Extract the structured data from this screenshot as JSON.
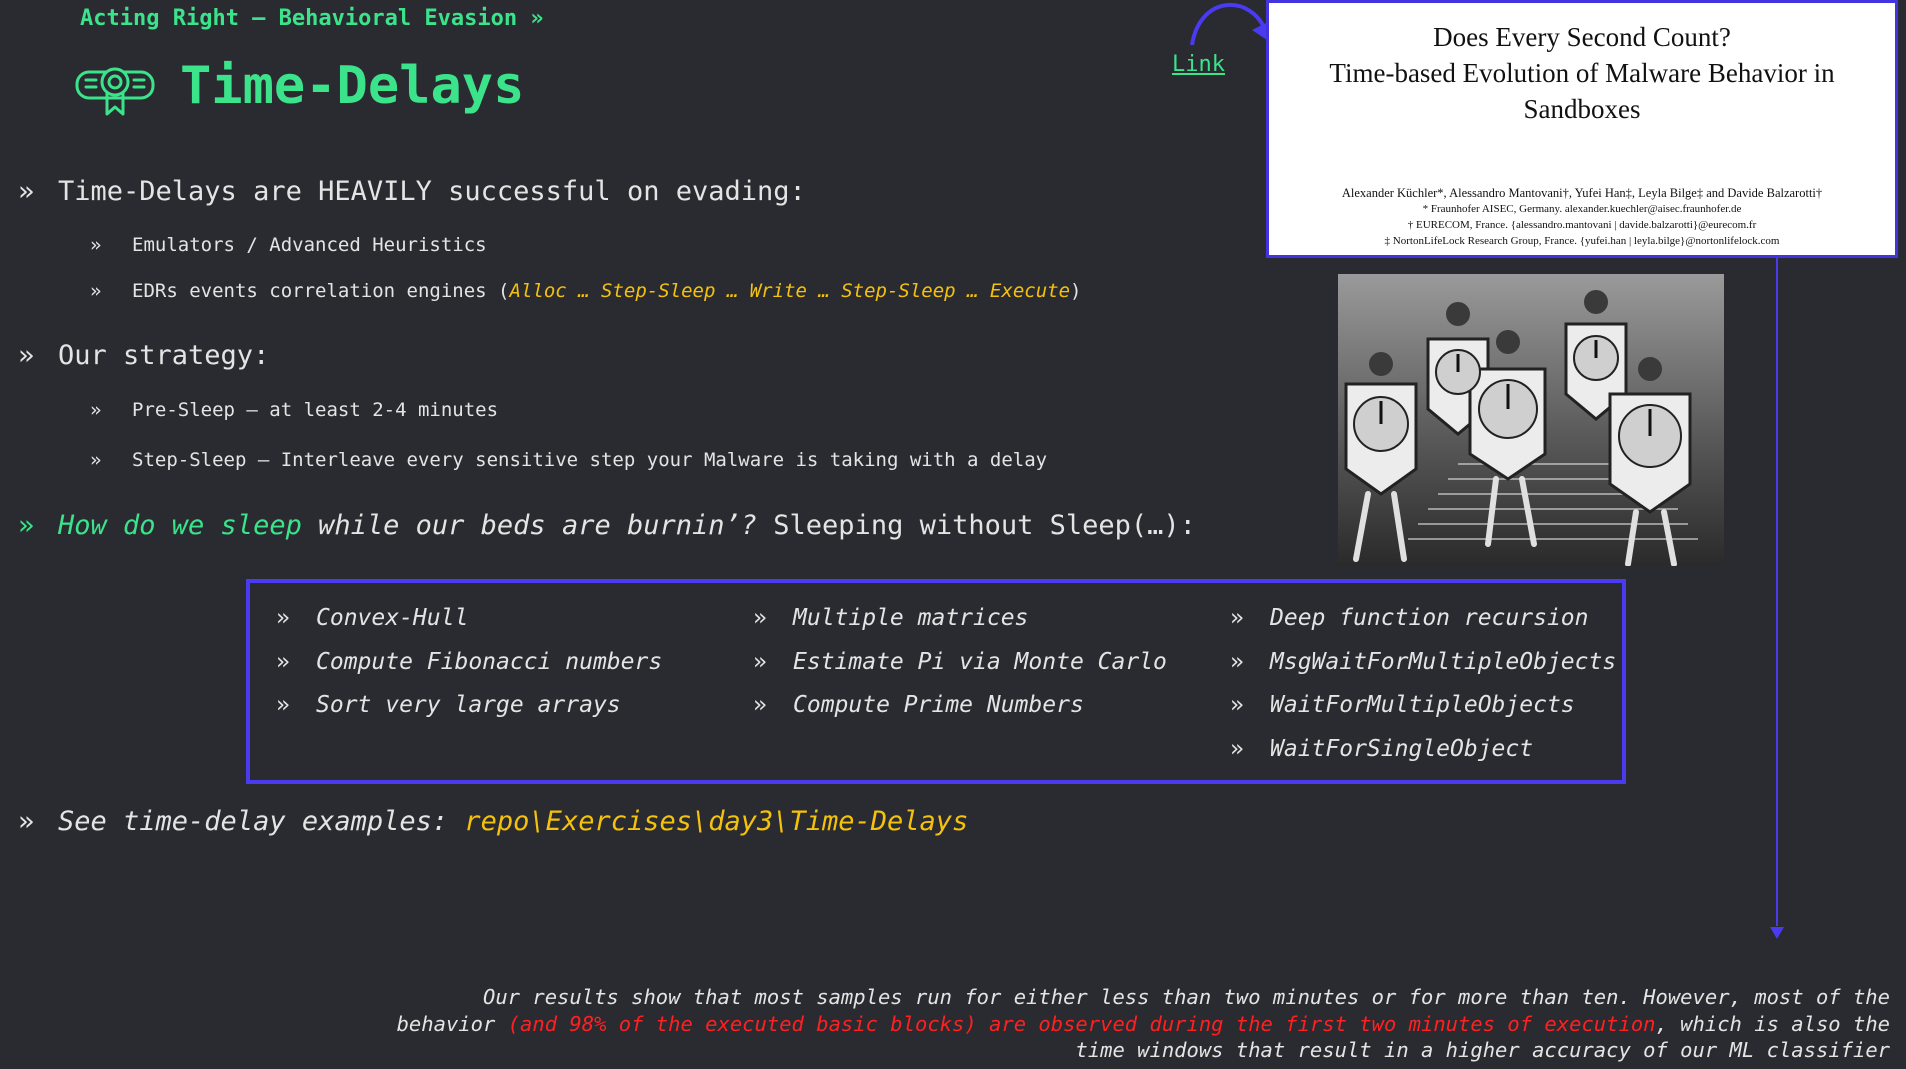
{
  "header": {
    "breadcrumb": "Acting Right – Behavioral Evasion »",
    "title": "Time-Delays",
    "icon": "certificate-icon"
  },
  "link_label": "Link",
  "bullets": {
    "marker": "»",
    "b1": "Time-Delays are HEAVILY successful on evading:",
    "b1_1": "Emulators / Advanced Heuristics",
    "b1_2_prefix": "EDRs events correlation engines (",
    "b1_2_highlight": "Alloc … Step-Sleep … Write … Step-Sleep … Execute",
    "b1_2_suffix": ")",
    "b2": "Our strategy:",
    "b2_1": "Pre-Sleep – at least 2-4 minutes",
    "b2_2": "Step-Sleep – Interleave every sensitive step your Malware is taking with a delay",
    "b3_green": "How do we sleep",
    "b3_italic": "while our beds are burnin’?",
    "b3_rest": "Sleeping without Sleep(…):",
    "b4_prefix": "See time-delay examples:",
    "b4_path": "repo\\Exercises\\day3\\Time-Delays"
  },
  "techniques": {
    "col1": [
      "Convex-Hull",
      "Compute Fibonacci numbers",
      "Sort very large arrays"
    ],
    "col2": [
      "Multiple matrices",
      "Estimate Pi via Monte Carlo",
      "Compute Prime Numbers"
    ],
    "col3": [
      "Deep function recursion",
      "MsgWaitForMultipleObjects",
      "WaitForMultipleObjects",
      "WaitForSingleObject"
    ]
  },
  "paper": {
    "title_line1": "Does Every Second Count?",
    "title_line2": "Time-based Evolution of Malware Behavior in",
    "title_line3": "Sandboxes",
    "authors": "Alexander Küchler*, Alessandro Mantovani†, Yufei Han‡, Leyla Bilge‡ and Davide Balzarotti†",
    "affil1": "* Fraunhofer AISEC, Germany. alexander.kuechler@aisec.fraunhofer.de",
    "affil2": "† EURECOM, France. {alessandro.mantovani | davide.balzarotti}@eurecom.fr",
    "affil3": "‡ NortonLifeLock Research Group, France. {yufei.han | leyla.bilge}@nortonlifelock.com"
  },
  "footer": {
    "line1": "Our results show that most samples run for either less than two minutes or for more than ten. However, most of the",
    "line2_prefix": "behavior ",
    "line2_red": "(and 98% of the executed basic blocks) are observed during the first two minutes of execution",
    "line2_suffix": ", which is also the",
    "line3": "time windows that result in a higher accuracy of our ML classifier"
  },
  "colors": {
    "background": "#2a2a31",
    "accent_green": "#3be38a",
    "highlight_yellow": "#f4c20d",
    "emphasis_red": "#ff2020",
    "frame_blue": "#4a3af0"
  }
}
